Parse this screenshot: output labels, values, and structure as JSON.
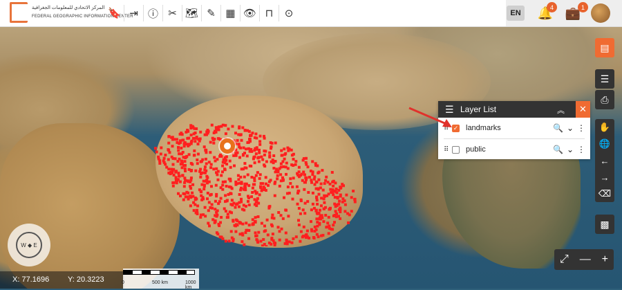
{
  "header": {
    "logo_ar": "المركز الاتحادي للمعلومات الجغرافية",
    "logo_en": "FEDERAL GEOGRAPHIC INFORMATION CENTER",
    "tools": [
      {
        "icon": "bookmark-icon",
        "glyph": "🔖"
      },
      {
        "icon": "login-icon",
        "glyph": "⇥"
      },
      {
        "icon": "info-icon",
        "glyph": "ⓘ"
      },
      {
        "icon": "scissors-icon",
        "glyph": "✂"
      },
      {
        "icon": "map-search-icon",
        "glyph": "🗺"
      },
      {
        "icon": "draw-icon",
        "glyph": "✎"
      },
      {
        "icon": "table-icon",
        "glyph": "▦"
      },
      {
        "icon": "eye-icon",
        "glyph": "👁"
      },
      {
        "icon": "bench-icon",
        "glyph": "⊓"
      },
      {
        "icon": "location-pin-icon",
        "glyph": "⊙"
      }
    ],
    "language": "EN",
    "notifications_count": "4",
    "tasks_count": "1"
  },
  "layer_list": {
    "title": "Layer List",
    "layers": [
      {
        "name": "landmarks",
        "checked": true
      },
      {
        "name": "public",
        "checked": false
      }
    ]
  },
  "status": {
    "x": "X: 77.1696",
    "y": "Y: 20.3223"
  },
  "scale": {
    "labels": [
      "0",
      "500 km",
      "1000 km"
    ]
  },
  "colors": {
    "accent": "#f06b32",
    "cluster": "#ff1f1f",
    "toolbar_dark": "#333333"
  }
}
